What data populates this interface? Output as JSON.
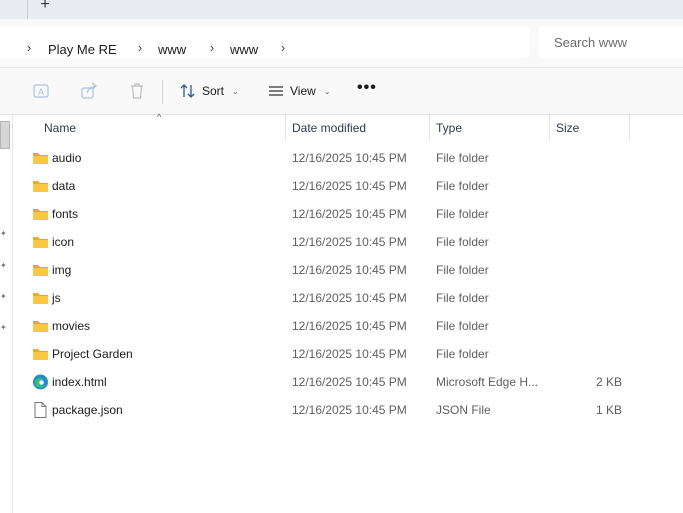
{
  "tabstrip": {
    "new_tab_glyph": "+"
  },
  "breadcrumb": {
    "items": [
      "Play Me RE",
      "www",
      "www"
    ]
  },
  "search": {
    "placeholder": "Search www"
  },
  "commands": {
    "sort_label": "Sort",
    "view_label": "View",
    "more_label": "•••"
  },
  "columns": {
    "name": "Name",
    "date": "Date modified",
    "type": "Type",
    "size": "Size"
  },
  "files": [
    {
      "name": "audio",
      "date": "12/16/2025 10:45 PM",
      "type": "File folder",
      "size": "",
      "icon": "folder-icon"
    },
    {
      "name": "data",
      "date": "12/16/2025 10:45 PM",
      "type": "File folder",
      "size": "",
      "icon": "folder-icon"
    },
    {
      "name": "fonts",
      "date": "12/16/2025 10:45 PM",
      "type": "File folder",
      "size": "",
      "icon": "folder-icon"
    },
    {
      "name": "icon",
      "date": "12/16/2025 10:45 PM",
      "type": "File folder",
      "size": "",
      "icon": "folder-icon"
    },
    {
      "name": "img",
      "date": "12/16/2025 10:45 PM",
      "type": "File folder",
      "size": "",
      "icon": "folder-icon"
    },
    {
      "name": "js",
      "date": "12/16/2025 10:45 PM",
      "type": "File folder",
      "size": "",
      "icon": "folder-icon"
    },
    {
      "name": "movies",
      "date": "12/16/2025 10:45 PM",
      "type": "File folder",
      "size": "",
      "icon": "folder-icon"
    },
    {
      "name": "Project Garden",
      "date": "12/16/2025 10:45 PM",
      "type": "File folder",
      "size": "",
      "icon": "folder-icon"
    },
    {
      "name": "index.html",
      "date": "12/16/2025 10:45 PM",
      "type": "Microsoft Edge H...",
      "size": "2 KB",
      "icon": "edge-icon"
    },
    {
      "name": "package.json",
      "date": "12/16/2025 10:45 PM",
      "type": "JSON File",
      "size": "1 KB",
      "icon": "file-icon"
    }
  ],
  "colors": {
    "folder": "#f8c840",
    "folder_dark": "#e6a92b",
    "accent": "#0067c0"
  }
}
